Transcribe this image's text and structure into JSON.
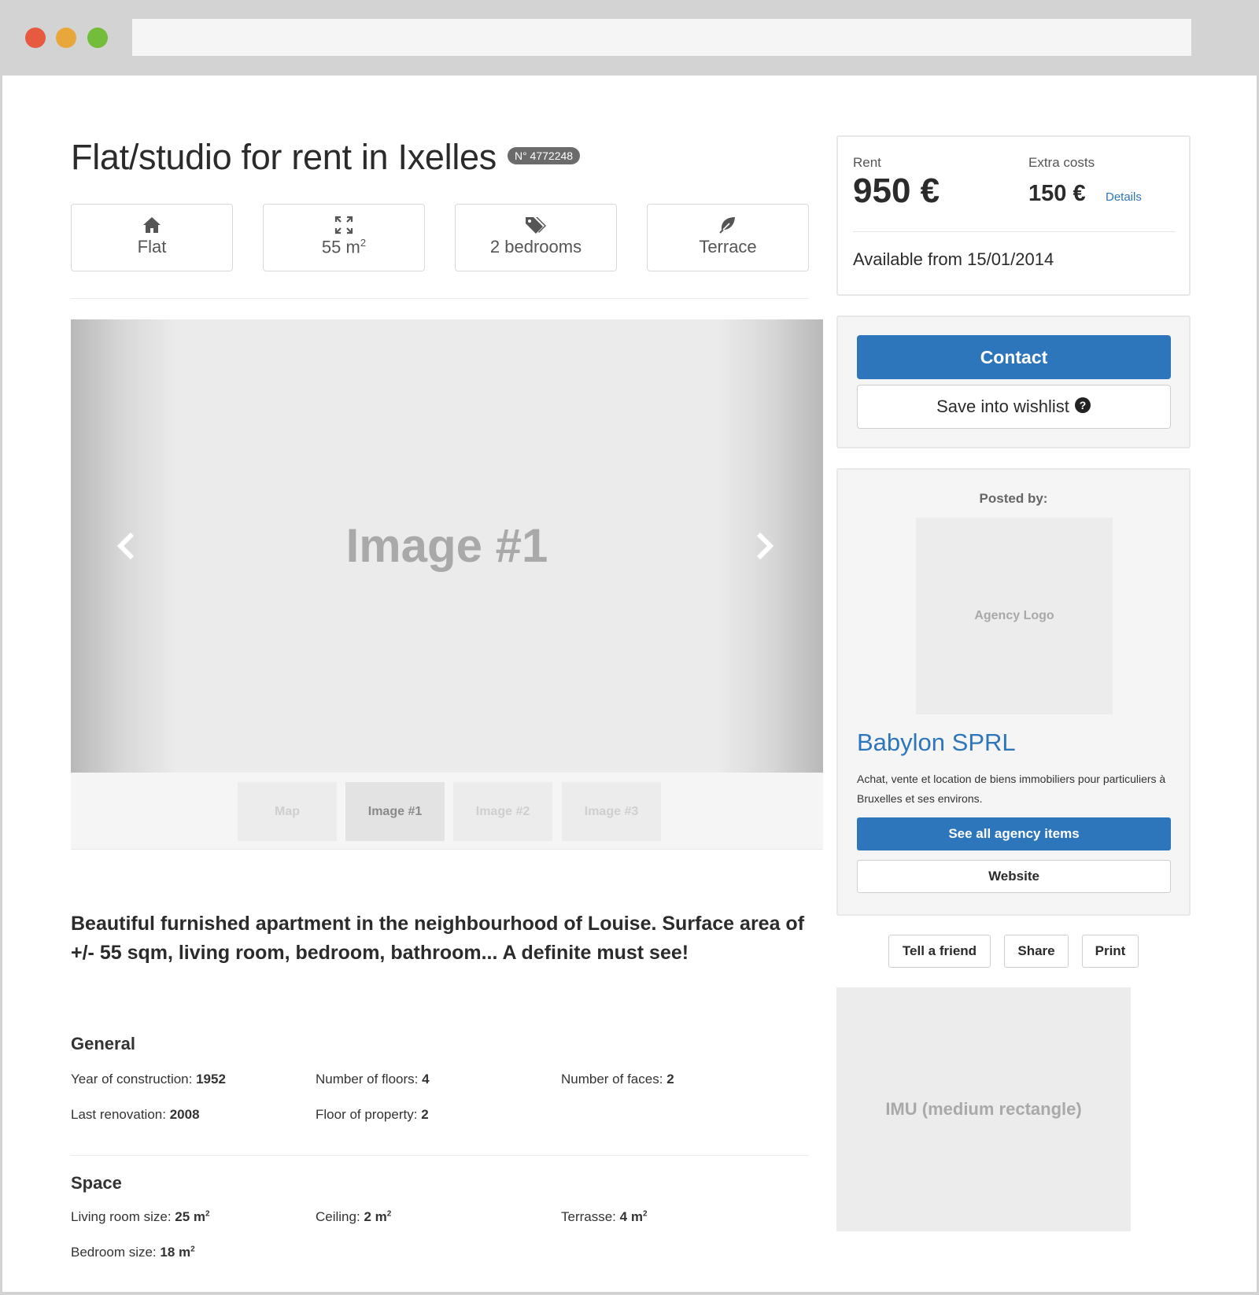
{
  "listing": {
    "title": "Flat/studio for rent in Ixelles",
    "reference": "N° 4772248"
  },
  "features": [
    {
      "icon": "home-icon",
      "label": "Flat"
    },
    {
      "icon": "expand-icon",
      "label": "55 m",
      "sup": "2"
    },
    {
      "icon": "tags-icon",
      "label": "2 bedrooms"
    },
    {
      "icon": "leaf-icon",
      "label": "Terrace"
    }
  ],
  "gallery": {
    "current_label": "Image #1",
    "thumbnails": [
      "Map",
      "Image #1",
      "Image #2",
      "Image #3"
    ],
    "active_thumbnail": "Image #1"
  },
  "description": "Beautiful furnished apartment in the neighbourhood of Louise. Surface area of +/- 55 sqm, living room, bedroom, bathroom... A definite must see!",
  "general": {
    "heading": "General",
    "items": [
      {
        "label": "Year of construction:",
        "value": "1952"
      },
      {
        "label": "Number of floors:",
        "value": "4"
      },
      {
        "label": "Number of faces:",
        "value": "2"
      },
      {
        "label": "Last renovation:",
        "value": "2008"
      },
      {
        "label": "Floor of property:",
        "value": "2"
      }
    ]
  },
  "space": {
    "heading": "Space",
    "items": [
      {
        "label": "Living room size:",
        "value": "25 m",
        "sup": "2"
      },
      {
        "label": "Ceiling:",
        "value": "2 m",
        "sup": "2"
      },
      {
        "label": "Terrasse:",
        "value": "4 m",
        "sup": "2"
      },
      {
        "label": "Bedroom size:",
        "value": "18 m",
        "sup": "2"
      }
    ]
  },
  "pricing": {
    "rent_label": "Rent",
    "rent_value": "950 €",
    "extra_label": "Extra costs",
    "extra_value": "150 €",
    "details_link": "Details",
    "available": "Available from 15/01/2014"
  },
  "actions": {
    "contact": "Contact",
    "wishlist": "Save into wishlist"
  },
  "agency": {
    "posted_by": "Posted by:",
    "logo_placeholder": "Agency Logo",
    "name": "Babylon SPRL",
    "description": "Achat, vente et location de biens immobiliers pour particuliers à Bruxelles et ses environs.",
    "see_all": "See all agency items",
    "website": "Website"
  },
  "share_buttons": {
    "tell_friend": "Tell a friend",
    "share": "Share",
    "print": "Print"
  },
  "ad": {
    "placeholder": "IMU (medium rectangle)"
  },
  "colors": {
    "accent": "#2e76bb",
    "window_close": "#e65a3f",
    "window_minimize": "#e8a73a",
    "window_maximize": "#73bd3a"
  }
}
